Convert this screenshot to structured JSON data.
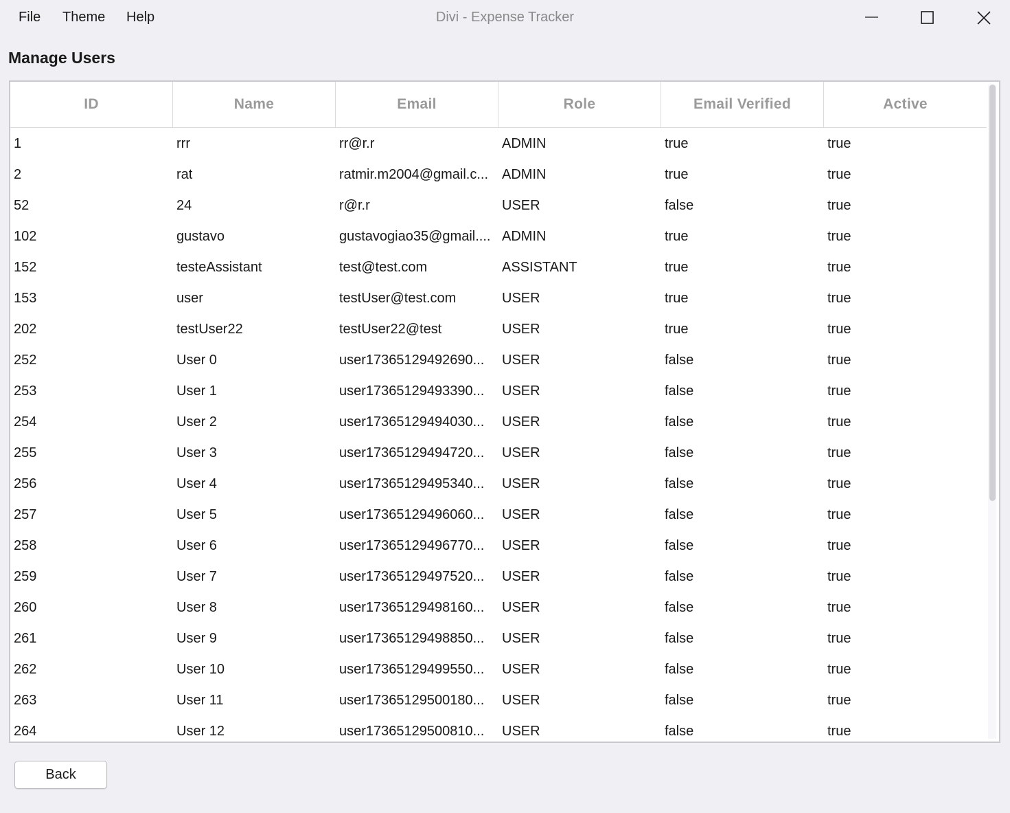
{
  "window": {
    "title": "Divi - Expense Tracker",
    "menu": [
      "File",
      "Theme",
      "Help"
    ]
  },
  "page": {
    "title": "Manage Users",
    "back_label": "Back"
  },
  "table": {
    "columns": [
      "ID",
      "Name",
      "Email",
      "Role",
      "Email Verified",
      "Active"
    ],
    "rows": [
      [
        "1",
        "rrr",
        "rr@r.r",
        "ADMIN",
        "true",
        "true"
      ],
      [
        "2",
        "rat",
        "ratmir.m2004@gmail.c...",
        "ADMIN",
        "true",
        "true"
      ],
      [
        "52",
        "24",
        "r@r.r",
        "USER",
        "false",
        "true"
      ],
      [
        "102",
        "gustavo",
        "gustavogiao35@gmail....",
        "ADMIN",
        "true",
        "true"
      ],
      [
        "152",
        "testeAssistant",
        "test@test.com",
        "ASSISTANT",
        "true",
        "true"
      ],
      [
        "153",
        "user",
        "testUser@test.com",
        "USER",
        "true",
        "true"
      ],
      [
        "202",
        "testUser22",
        "testUser22@test",
        "USER",
        "true",
        "true"
      ],
      [
        "252",
        "User 0",
        "user17365129492690...",
        "USER",
        "false",
        "true"
      ],
      [
        "253",
        "User 1",
        "user17365129493390...",
        "USER",
        "false",
        "true"
      ],
      [
        "254",
        "User 2",
        "user17365129494030...",
        "USER",
        "false",
        "true"
      ],
      [
        "255",
        "User 3",
        "user17365129494720...",
        "USER",
        "false",
        "true"
      ],
      [
        "256",
        "User 4",
        "user17365129495340...",
        "USER",
        "false",
        "true"
      ],
      [
        "257",
        "User 5",
        "user17365129496060...",
        "USER",
        "false",
        "true"
      ],
      [
        "258",
        "User 6",
        "user17365129496770...",
        "USER",
        "false",
        "true"
      ],
      [
        "259",
        "User 7",
        "user17365129497520...",
        "USER",
        "false",
        "true"
      ],
      [
        "260",
        "User 8",
        "user17365129498160...",
        "USER",
        "false",
        "true"
      ],
      [
        "261",
        "User 9",
        "user17365129498850...",
        "USER",
        "false",
        "true"
      ],
      [
        "262",
        "User 10",
        "user17365129499550...",
        "USER",
        "false",
        "true"
      ],
      [
        "263",
        "User 11",
        "user17365129500180...",
        "USER",
        "false",
        "true"
      ],
      [
        "264",
        "User 12",
        "user17365129500810...",
        "USER",
        "false",
        "true"
      ]
    ]
  },
  "icons": {
    "minimize": "minimize-icon",
    "maximize": "maximize-icon",
    "close": "close-icon"
  },
  "colors": {
    "background": "#f0eff4",
    "header_text": "#9a9a9a",
    "title_text": "#8a8a8a"
  }
}
